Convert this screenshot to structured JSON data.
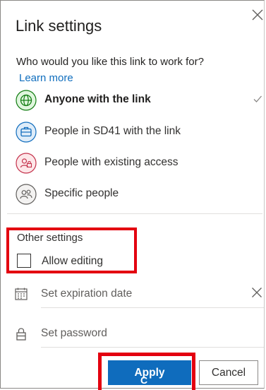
{
  "dialog": {
    "title": "Link settings",
    "question": "Who would you like this link to work for?",
    "learn_more": "Learn more"
  },
  "audience_options": [
    {
      "label": "Anyone with the link",
      "icon": "globe-icon",
      "selected": true
    },
    {
      "label": "People in SD41 with the link",
      "icon": "organization-icon",
      "selected": false
    },
    {
      "label": "People with existing access",
      "icon": "existing-access-icon",
      "selected": false
    },
    {
      "label": "Specific people",
      "icon": "people-icon",
      "selected": false
    }
  ],
  "other_settings": {
    "heading": "Other settings",
    "allow_editing_label": "Allow editing",
    "allow_editing_checked": false
  },
  "expiration": {
    "placeholder": "Set expiration date",
    "icon": "calendar-icon"
  },
  "password": {
    "placeholder": "Set password",
    "icon": "lock-icon"
  },
  "buttons": {
    "apply": "Apply",
    "cancel": "Cancel"
  },
  "cursor_text": "C",
  "colors": {
    "accent": "#0f6cbd",
    "link": "#106ebe",
    "highlight_box": "#e3000f",
    "globe": "#107c10",
    "organization": "#0f6cbd",
    "existing_access": "#c4314b",
    "people": "#605e5c"
  }
}
